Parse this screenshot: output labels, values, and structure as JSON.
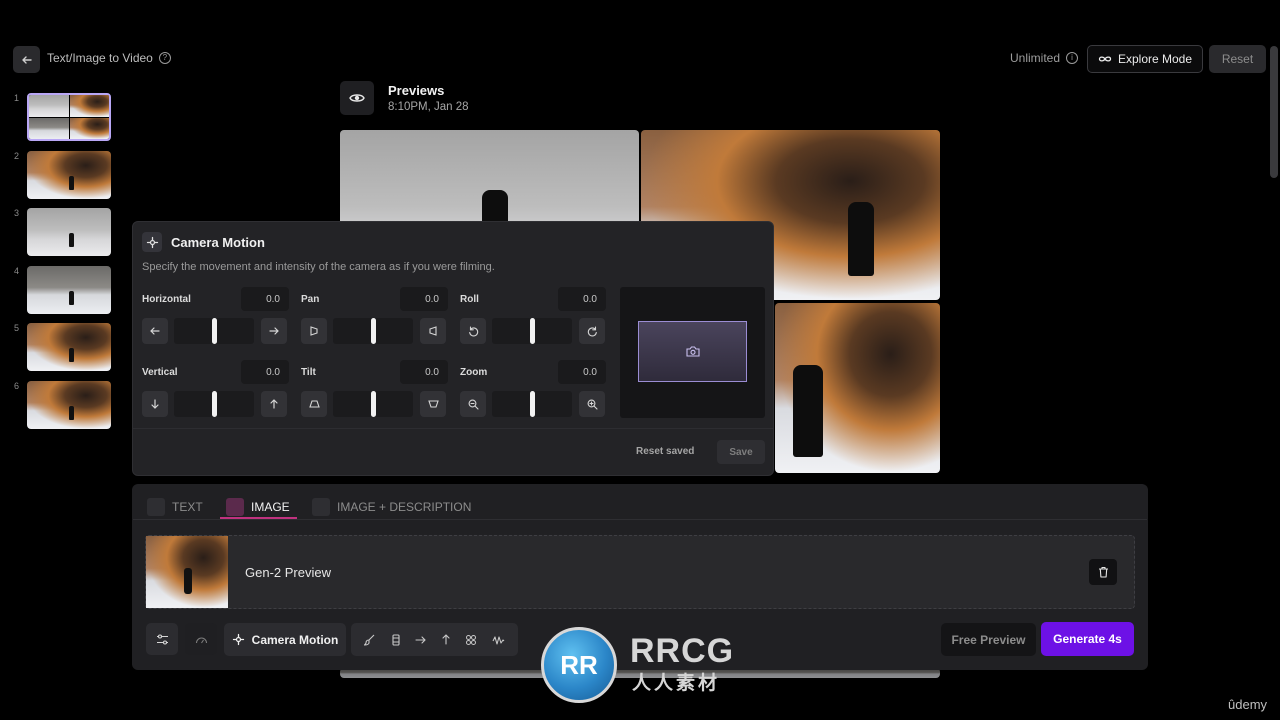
{
  "topbar": {
    "page_title": "Text/Image to Video",
    "unlimited_label": "Unlimited",
    "explore_mode_label": "Explore Mode",
    "reset_label": "Reset"
  },
  "thumbnails": {
    "numbers": [
      "1",
      "2",
      "3",
      "4",
      "5",
      "6"
    ],
    "selected_index": 1
  },
  "previews": {
    "title": "Previews",
    "timestamp": "8:10PM, Jan 28"
  },
  "camera_motion": {
    "title": "Camera Motion",
    "description": "Specify the movement and intensity of the camera as if you were filming.",
    "controls": [
      {
        "label": "Horizontal",
        "value": "0.0"
      },
      {
        "label": "Pan",
        "value": "0.0"
      },
      {
        "label": "Roll",
        "value": "0.0"
      },
      {
        "label": "Vertical",
        "value": "0.0"
      },
      {
        "label": "Tilt",
        "value": "0.0"
      },
      {
        "label": "Zoom",
        "value": "0.0"
      }
    ],
    "reset_saved_label": "Reset saved",
    "save_label": "Save"
  },
  "input_tabs": [
    {
      "label": "TEXT",
      "active": false
    },
    {
      "label": "IMAGE",
      "active": true
    },
    {
      "label": "IMAGE + DESCRIPTION",
      "active": false
    }
  ],
  "image_input": {
    "label": "Gen-2 Preview"
  },
  "toolbar": {
    "camera_motion_label": "Camera Motion",
    "free_preview_label": "Free Preview",
    "generate_label": "Generate 4s"
  },
  "watermark": {
    "text": "RRCG",
    "subtext": "人人素材",
    "brand": "ûdemy"
  },
  "colors": {
    "accent": "#6d11e6",
    "tab_active_underline": "#c0327f",
    "camera_frame": "#9b8dd4"
  }
}
